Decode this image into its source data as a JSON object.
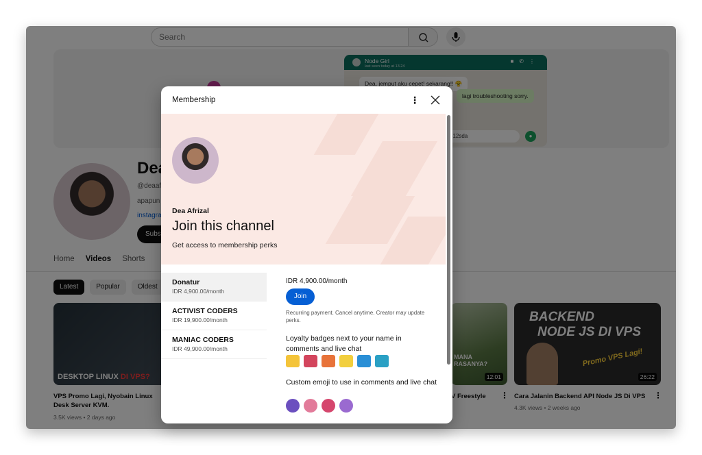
{
  "search": {
    "placeholder": "Search"
  },
  "banner": {
    "chat_name": "Node Girl",
    "chat_status": "last seen today at 13.24",
    "msg1": "Dea, jemput aku cepet! sekarang!! 😤",
    "msg2": "lagi troubleshooting sorry.",
    "input_text": "312sda"
  },
  "channel": {
    "name": "Dea",
    "handle": "@deaaf",
    "desc": "apapun",
    "link": "instagra",
    "subscribe": "Subs"
  },
  "tabs": [
    "Home",
    "Videos",
    "Shorts"
  ],
  "chips": [
    "Latest",
    "Popular",
    "Oldest"
  ],
  "videos": [
    {
      "thumb_text_a": "DESKTOP LINUX ",
      "thumb_text_b": "DI VPS?",
      "title": "VPS Promo Lagi, Nyobain Linux Desk Server KVM.",
      "meta": "3.5K views • 2 days ago"
    },
    {
      "thumb_text": "MANA RASANYA?",
      "duration": "12:01",
      "title": "V Freestyle"
    },
    {
      "thumb_line1": "BACKEND",
      "thumb_line2": "NODE JS DI VPS",
      "promo": "Promo VPS Lagi!",
      "duration": "26:22",
      "title": "Cara Jalanin Backend API Node JS Di VPS",
      "meta": "4.3K views • 2 weeks ago"
    }
  ],
  "modal": {
    "title": "Membership",
    "owner": "Dea Afrizal",
    "heading": "Join this channel",
    "subheading": "Get access to membership perks",
    "tiers": [
      {
        "name": "Donatur",
        "price": "IDR 4,900.00/month"
      },
      {
        "name": "ACTIVIST CODERS",
        "price": "IDR 19,900.00/month"
      },
      {
        "name": "MANIAC CODERS",
        "price": "IDR 49,900.00/month"
      }
    ],
    "detail": {
      "price": "IDR 4,900.00/month",
      "join_label": "Join",
      "note": "Recurring payment. Cancel anytime. Creator may update perks.",
      "perk1": "Loyalty badges next to your name in comments and live chat",
      "perk2": "Custom emoji to use in comments and live chat"
    }
  },
  "colors": {
    "accent": "#065fd4",
    "hero_bg": "#fbe9e4",
    "whatsapp_green": "#0b6e5f"
  }
}
